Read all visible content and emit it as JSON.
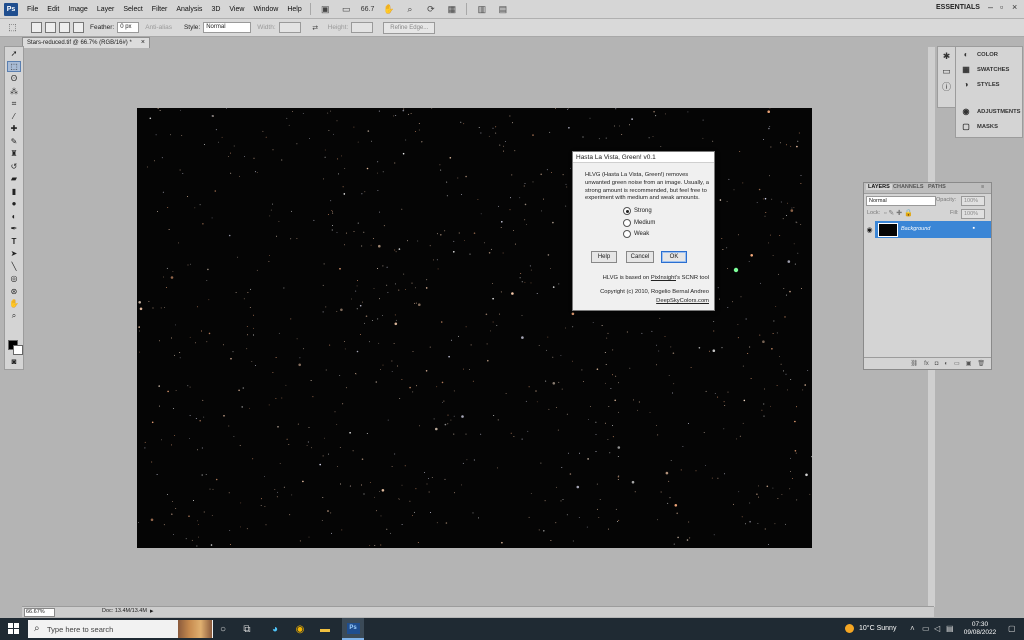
{
  "app": {
    "logo": "Ps",
    "menu": [
      "File",
      "Edit",
      "Image",
      "Layer",
      "Select",
      "Filter",
      "Analysis",
      "3D",
      "View",
      "Window",
      "Help"
    ],
    "zoom": "66.7",
    "workspace": "ESSENTIALS"
  },
  "options": {
    "feather_label": "Feather:",
    "feather_value": "0 px",
    "antialias_label": "Anti-alias",
    "style_label": "Style:",
    "style_value": "Normal",
    "width_label": "Width:",
    "height_label": "Height:",
    "refine_edge": "Refine Edge..."
  },
  "document": {
    "tab_title": "Stars-reduced.tif @ 66.7% (RGB/16#)",
    "tab_modified": "*",
    "tab_close": "×"
  },
  "dialog": {
    "title": "Hasta La Vista, Green! v0.1",
    "description": "HLVG (Hasta La Vista, Green!) removes unwanted green noise from an image. Usually, a strong amount is recommended, but feel free to experiment with medium and weak amounts.",
    "options": [
      {
        "label": "Strong",
        "selected": true
      },
      {
        "label": "Medium",
        "selected": false
      },
      {
        "label": "Weak",
        "selected": false
      }
    ],
    "buttons": {
      "help": "Help",
      "cancel": "Cancel",
      "ok": "OK"
    },
    "based_on_prefix": "HLVG is based on ",
    "based_on_link": "PixInsight",
    "based_on_suffix": "'s SCNR tool",
    "copyright": "Copyright (c) 2010, Rogelio Bernal Andreo",
    "website": "DeepSkyColors.com"
  },
  "dock": {
    "items": [
      {
        "label": "COLOR",
        "icon": "color-icon"
      },
      {
        "label": "SWATCHES",
        "icon": "swatches-icon"
      },
      {
        "label": "STYLES",
        "icon": "styles-icon"
      },
      {
        "label": "ADJUSTMENTS",
        "icon": "adjustments-icon"
      },
      {
        "label": "MASKS",
        "icon": "masks-icon"
      }
    ]
  },
  "layers_panel": {
    "tabs": [
      "LAYERS",
      "CHANNELS",
      "PATHS"
    ],
    "blend_mode": "Normal",
    "opacity_label": "Opacity:",
    "opacity_value": "100%",
    "lock_label": "Lock:",
    "fill_label": "Fill:",
    "fill_value": "100%",
    "layer_name": "Background"
  },
  "status": {
    "zoom": "66.67%",
    "doc": "Doc: 13.4M/13.4M"
  },
  "taskbar": {
    "search_placeholder": "Type here to search",
    "temperature": "10°C",
    "weather": "Sunny",
    "time": "07:30",
    "date": "09/08/2022"
  },
  "colors": {
    "dialog_default_border": "#2b6fd0",
    "layer_selected": "#3b86d6",
    "taskbar": "#1f2a33",
    "ps_blue": "#1f4e8f"
  }
}
